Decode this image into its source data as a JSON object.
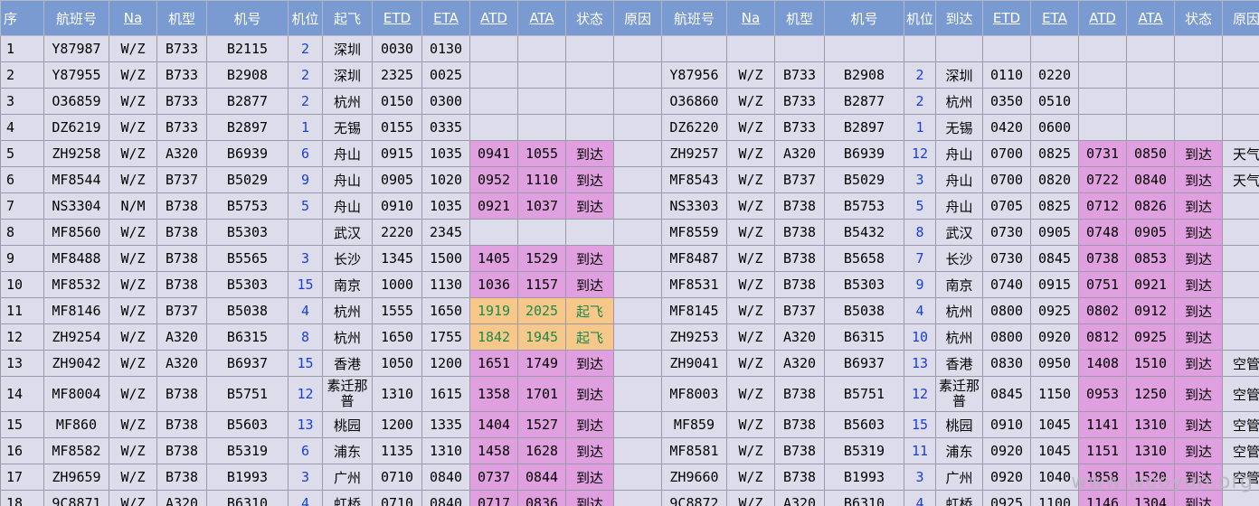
{
  "headers": [
    "序",
    "航班号",
    "Na",
    "机型",
    "机号",
    "机位",
    "起飞",
    "ETD",
    "ETA",
    "ATD",
    "ATA",
    "状态",
    "原因",
    "航班号",
    "Na",
    "机型",
    "机号",
    "机位",
    "到达",
    "ETD",
    "ETA",
    "ATD",
    "ATA",
    "状态",
    "原因"
  ],
  "rows": [
    {
      "seq": "1",
      "f1": "Y87987",
      "na1": "W/Z",
      "type1": "B733",
      "reg1": "B2115",
      "pos1": "2",
      "from": "深圳",
      "etd1": "0030",
      "eta1": "0130",
      "atd1": "",
      "ata1": "",
      "st1": "",
      "rsn1": "",
      "f2": "",
      "na2": "",
      "type2": "",
      "reg2": "",
      "pos2": "",
      "to": "",
      "etd2": "",
      "eta2": "",
      "atd2": "",
      "ata2": "",
      "st2": "",
      "rsn2": ""
    },
    {
      "seq": "2",
      "f1": "Y87955",
      "na1": "W/Z",
      "type1": "B733",
      "reg1": "B2908",
      "pos1": "2",
      "from": "深圳",
      "etd1": "2325",
      "eta1": "0025",
      "atd1": "",
      "ata1": "",
      "st1": "",
      "rsn1": "",
      "f2": "Y87956",
      "na2": "W/Z",
      "type2": "B733",
      "reg2": "B2908",
      "pos2": "2",
      "to": "深圳",
      "etd2": "0110",
      "eta2": "0220",
      "atd2": "",
      "ata2": "",
      "st2": "",
      "rsn2": ""
    },
    {
      "seq": "3",
      "f1": "O36859",
      "na1": "W/Z",
      "type1": "B733",
      "reg1": "B2877",
      "pos1": "2",
      "from": "杭州",
      "etd1": "0150",
      "eta1": "0300",
      "atd1": "",
      "ata1": "",
      "st1": "",
      "rsn1": "",
      "f2": "O36860",
      "na2": "W/Z",
      "type2": "B733",
      "reg2": "B2877",
      "pos2": "2",
      "to": "杭州",
      "etd2": "0350",
      "eta2": "0510",
      "atd2": "",
      "ata2": "",
      "st2": "",
      "rsn2": ""
    },
    {
      "seq": "4",
      "f1": "DZ6219",
      "na1": "W/Z",
      "type1": "B733",
      "reg1": "B2897",
      "pos1": "1",
      "from": "无锡",
      "etd1": "0155",
      "eta1": "0335",
      "atd1": "",
      "ata1": "",
      "st1": "",
      "rsn1": "",
      "f2": "DZ6220",
      "na2": "W/Z",
      "type2": "B733",
      "reg2": "B2897",
      "pos2": "1",
      "to": "无锡",
      "etd2": "0420",
      "eta2": "0600",
      "atd2": "",
      "ata2": "",
      "st2": "",
      "rsn2": ""
    },
    {
      "seq": "5",
      "f1": "ZH9258",
      "na1": "W/Z",
      "type1": "A320",
      "reg1": "B6939",
      "pos1": "6",
      "from": "舟山",
      "etd1": "0915",
      "eta1": "1035",
      "atd1": "0941",
      "ata1": "1055",
      "st1": "到达",
      "rsn1": "",
      "f2": "ZH9257",
      "na2": "W/Z",
      "type2": "A320",
      "reg2": "B6939",
      "pos2": "12",
      "to": "舟山",
      "etd2": "0700",
      "eta2": "0825",
      "atd2": "0731",
      "ata2": "0850",
      "st2": "到达",
      "rsn2": "天气"
    },
    {
      "seq": "6",
      "f1": "MF8544",
      "na1": "W/Z",
      "type1": "B737",
      "reg1": "B5029",
      "pos1": "9",
      "from": "舟山",
      "etd1": "0905",
      "eta1": "1020",
      "atd1": "0952",
      "ata1": "1110",
      "st1": "到达",
      "rsn1": "",
      "f2": "MF8543",
      "na2": "W/Z",
      "type2": "B737",
      "reg2": "B5029",
      "pos2": "3",
      "to": "舟山",
      "etd2": "0700",
      "eta2": "0820",
      "atd2": "0722",
      "ata2": "0840",
      "st2": "到达",
      "rsn2": "天气"
    },
    {
      "seq": "7",
      "f1": "NS3304",
      "na1": "N/M",
      "type1": "B738",
      "reg1": "B5753",
      "pos1": "5",
      "from": "舟山",
      "etd1": "0910",
      "eta1": "1035",
      "atd1": "0921",
      "ata1": "1037",
      "st1": "到达",
      "rsn1": "",
      "f2": "NS3303",
      "na2": "W/Z",
      "type2": "B738",
      "reg2": "B5753",
      "pos2": "5",
      "to": "舟山",
      "etd2": "0705",
      "eta2": "0825",
      "atd2": "0712",
      "ata2": "0826",
      "st2": "到达",
      "rsn2": ""
    },
    {
      "seq": "8",
      "f1": "MF8560",
      "na1": "W/Z",
      "type1": "B738",
      "reg1": "B5303",
      "pos1": "",
      "from": "武汉",
      "etd1": "2220",
      "eta1": "2345",
      "atd1": "",
      "ata1": "",
      "st1": "",
      "rsn1": "",
      "f2": "MF8559",
      "na2": "W/Z",
      "type2": "B738",
      "reg2": "B5432",
      "pos2": "8",
      "to": "武汉",
      "etd2": "0730",
      "eta2": "0905",
      "atd2": "0748",
      "ata2": "0905",
      "st2": "到达",
      "rsn2": ""
    },
    {
      "seq": "9",
      "f1": "MF8488",
      "na1": "W/Z",
      "type1": "B738",
      "reg1": "B5565",
      "pos1": "3",
      "from": "长沙",
      "etd1": "1345",
      "eta1": "1500",
      "atd1": "1405",
      "ata1": "1529",
      "st1": "到达",
      "rsn1": "",
      "f2": "MF8487",
      "na2": "W/Z",
      "type2": "B738",
      "reg2": "B5658",
      "pos2": "7",
      "to": "长沙",
      "etd2": "0730",
      "eta2": "0845",
      "atd2": "0738",
      "ata2": "0853",
      "st2": "到达",
      "rsn2": ""
    },
    {
      "seq": "10",
      "f1": "MF8532",
      "na1": "W/Z",
      "type1": "B738",
      "reg1": "B5303",
      "pos1": "15",
      "from": "南京",
      "etd1": "1000",
      "eta1": "1130",
      "atd1": "1036",
      "ata1": "1157",
      "st1": "到达",
      "rsn1": "",
      "f2": "MF8531",
      "na2": "W/Z",
      "type2": "B738",
      "reg2": "B5303",
      "pos2": "9",
      "to": "南京",
      "etd2": "0740",
      "eta2": "0915",
      "atd2": "0751",
      "ata2": "0921",
      "st2": "到达",
      "rsn2": ""
    },
    {
      "seq": "11",
      "f1": "MF8146",
      "na1": "W/Z",
      "type1": "B737",
      "reg1": "B5038",
      "pos1": "4",
      "from": "杭州",
      "etd1": "1555",
      "eta1": "1650",
      "atd1": "1919",
      "ata1": "2025",
      "st1": "起飞",
      "rsn1": "",
      "f2": "MF8145",
      "na2": "W/Z",
      "type2": "B737",
      "reg2": "B5038",
      "pos2": "4",
      "to": "杭州",
      "etd2": "0800",
      "eta2": "0925",
      "atd2": "0802",
      "ata2": "0912",
      "st2": "到达",
      "rsn2": ""
    },
    {
      "seq": "12",
      "f1": "ZH9254",
      "na1": "W/Z",
      "type1": "A320",
      "reg1": "B6315",
      "pos1": "8",
      "from": "杭州",
      "etd1": "1650",
      "eta1": "1755",
      "atd1": "1842",
      "ata1": "1945",
      "st1": "起飞",
      "rsn1": "",
      "f2": "ZH9253",
      "na2": "W/Z",
      "type2": "A320",
      "reg2": "B6315",
      "pos2": "10",
      "to": "杭州",
      "etd2": "0800",
      "eta2": "0920",
      "atd2": "0812",
      "ata2": "0925",
      "st2": "到达",
      "rsn2": ""
    },
    {
      "seq": "13",
      "f1": "ZH9042",
      "na1": "W/Z",
      "type1": "A320",
      "reg1": "B6937",
      "pos1": "15",
      "from": "香港",
      "etd1": "1050",
      "eta1": "1200",
      "atd1": "1651",
      "ata1": "1749",
      "st1": "到达",
      "rsn1": "",
      "f2": "ZH9041",
      "na2": "W/Z",
      "type2": "A320",
      "reg2": "B6937",
      "pos2": "13",
      "to": "香港",
      "etd2": "0830",
      "eta2": "0950",
      "atd2": "1408",
      "ata2": "1510",
      "st2": "到达",
      "rsn2": "空管"
    },
    {
      "seq": "14",
      "f1": "MF8004",
      "na1": "W/Z",
      "type1": "B738",
      "reg1": "B5751",
      "pos1": "12",
      "from": "素迁那普",
      "etd1": "1310",
      "eta1": "1615",
      "atd1": "1358",
      "ata1": "1701",
      "st1": "到达",
      "rsn1": "",
      "f2": "MF8003",
      "na2": "W/Z",
      "type2": "B738",
      "reg2": "B5751",
      "pos2": "12",
      "to": "素迁那普",
      "etd2": "0845",
      "eta2": "1150",
      "atd2": "0953",
      "ata2": "1250",
      "st2": "到达",
      "rsn2": "空管",
      "tall": true
    },
    {
      "seq": "15",
      "f1": "MF860",
      "na1": "W/Z",
      "type1": "B738",
      "reg1": "B5603",
      "pos1": "13",
      "from": "桃园",
      "etd1": "1200",
      "eta1": "1335",
      "atd1": "1404",
      "ata1": "1527",
      "st1": "到达",
      "rsn1": "",
      "f2": "MF859",
      "na2": "W/Z",
      "type2": "B738",
      "reg2": "B5603",
      "pos2": "15",
      "to": "桃园",
      "etd2": "0910",
      "eta2": "1045",
      "atd2": "1141",
      "ata2": "1310",
      "st2": "到达",
      "rsn2": "空管"
    },
    {
      "seq": "16",
      "f1": "MF8582",
      "na1": "W/Z",
      "type1": "B738",
      "reg1": "B5319",
      "pos1": "6",
      "from": "浦东",
      "etd1": "1135",
      "eta1": "1310",
      "atd1": "1458",
      "ata1": "1628",
      "st1": "到达",
      "rsn1": "",
      "f2": "MF8581",
      "na2": "W/Z",
      "type2": "B738",
      "reg2": "B5319",
      "pos2": "11",
      "to": "浦东",
      "etd2": "0920",
      "eta2": "1045",
      "atd2": "1151",
      "ata2": "1310",
      "st2": "到达",
      "rsn2": "空管"
    },
    {
      "seq": "17",
      "f1": "ZH9659",
      "na1": "W/Z",
      "type1": "B738",
      "reg1": "B1993",
      "pos1": "3",
      "from": "广州",
      "etd1": "0710",
      "eta1": "0840",
      "atd1": "0737",
      "ata1": "0844",
      "st1": "到达",
      "rsn1": "",
      "f2": "ZH9660",
      "na2": "W/Z",
      "type2": "B738",
      "reg2": "B1993",
      "pos2": "3",
      "to": "广州",
      "etd2": "0920",
      "eta2": "1040",
      "atd2": "1858",
      "ata2": "1520",
      "st2": "到达",
      "rsn2": "空管"
    },
    {
      "seq": "18",
      "f1": "9C8871",
      "na1": "W/Z",
      "type1": "A320",
      "reg1": "B6310",
      "pos1": "4",
      "from": "虹桥",
      "etd1": "0710",
      "eta1": "0840",
      "atd1": "0717",
      "ata1": "0836",
      "st1": "到达",
      "rsn1": "",
      "f2": "9C8872",
      "na2": "W/Z",
      "type2": "A320",
      "reg2": "B6310",
      "pos2": "4",
      "to": "虹桥",
      "etd2": "0925",
      "eta2": "1100",
      "atd2": "1146",
      "ata2": "1304",
      "st2": "到达",
      "rsn2": ""
    }
  ],
  "watermark": "www.wooyun.org"
}
